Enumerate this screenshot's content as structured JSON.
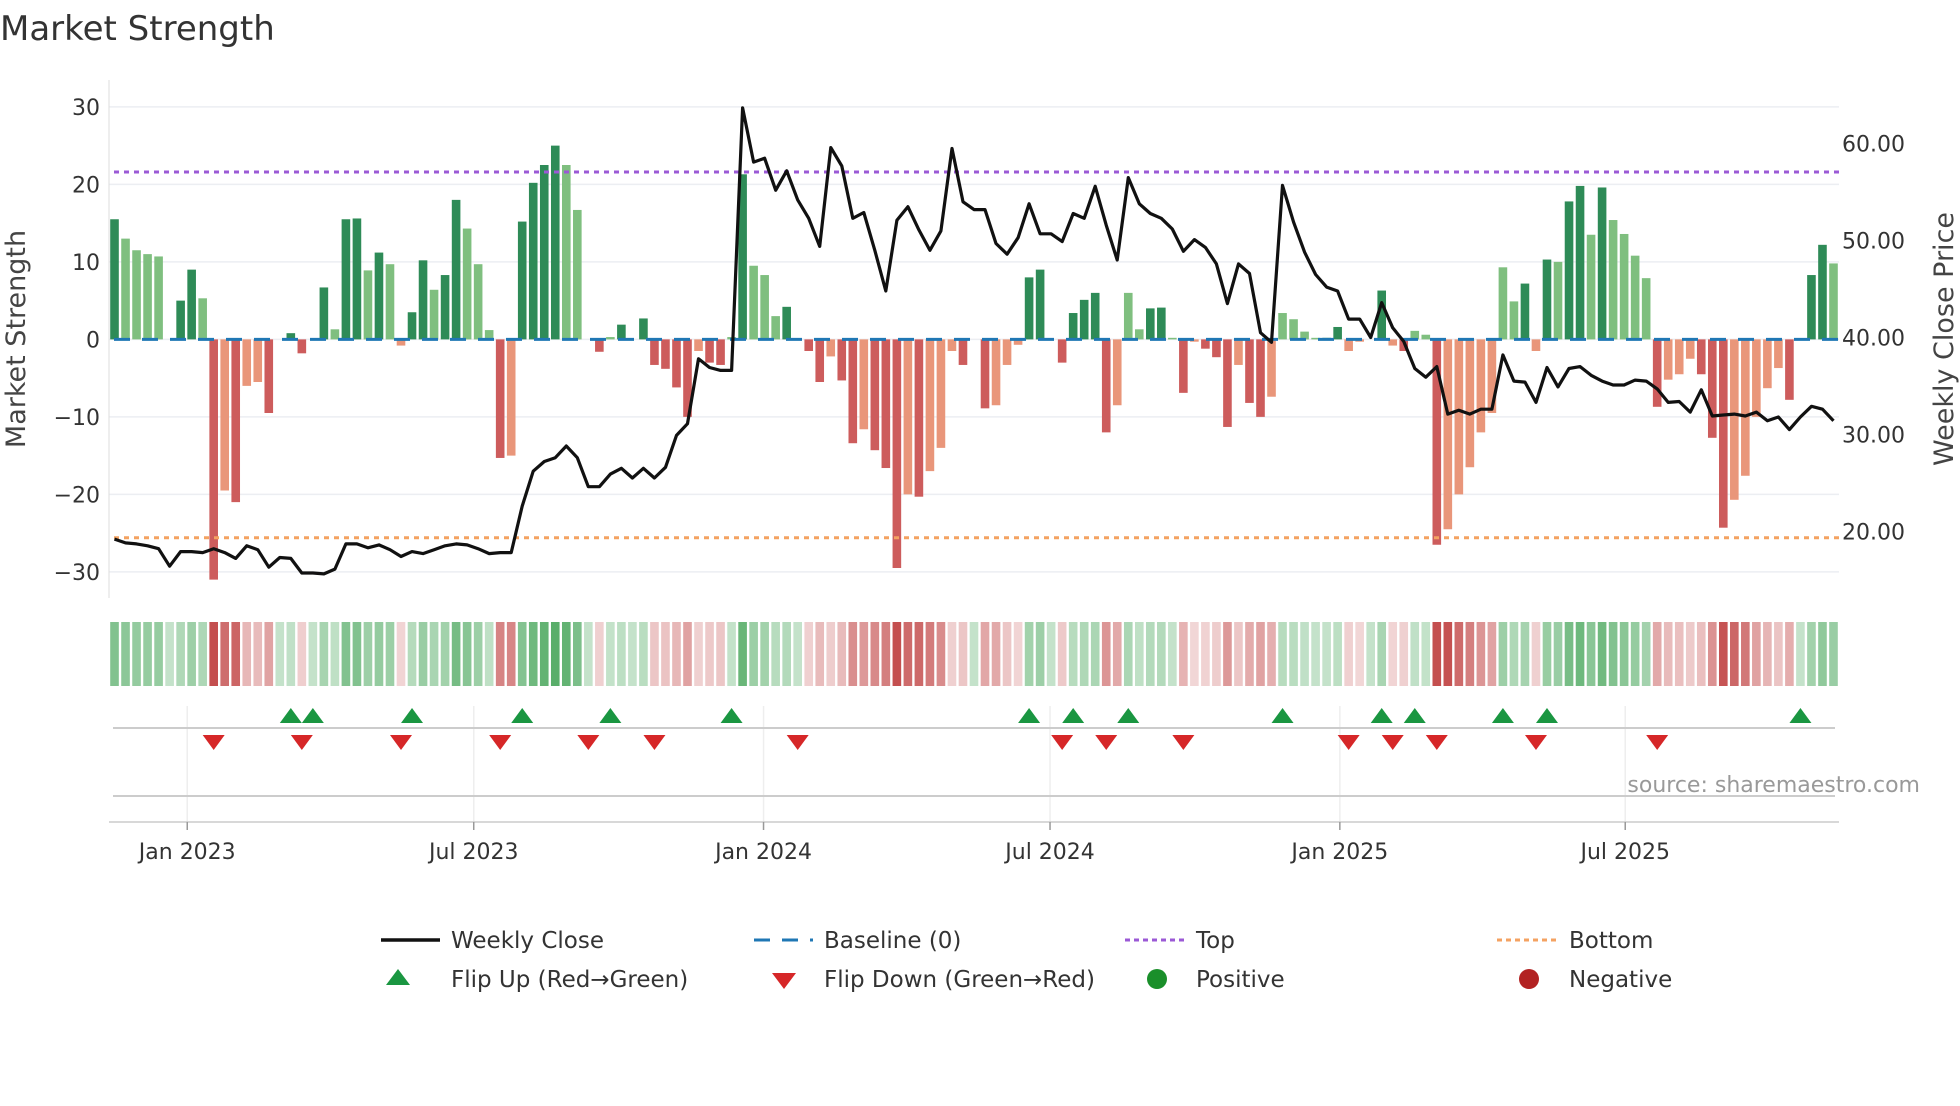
{
  "chart_data": {
    "type": "bar",
    "title": "Market Strength",
    "ylabel": "Market Strength",
    "y2label": "Weekly Close Price",
    "ylim": [
      -33,
      33
    ],
    "y2lim": [
      15.2,
      67.7
    ],
    "yticks": [
      "30",
      "20",
      "10",
      "0",
      "−10",
      "−20",
      "−30"
    ],
    "ytick_values": [
      30,
      20,
      10,
      0,
      -10,
      -20,
      -30
    ],
    "y2ticks": [
      "60.00",
      "50.00",
      "40.00",
      "30.00",
      "20.00"
    ],
    "y2tick_values": [
      60,
      50,
      40,
      30,
      20
    ],
    "x_unit": "week index (weekly, starting mid-Nov 2022)",
    "xticks": [
      {
        "label": "Jan 2023",
        "week": 6.6
      },
      {
        "label": "Jul 2023",
        "week": 32.6
      },
      {
        "label": "Jan 2024",
        "week": 58.9
      },
      {
        "label": "Jul 2024",
        "week": 84.9
      },
      {
        "label": "Jan 2025",
        "week": 111.2
      },
      {
        "label": "Jul 2025",
        "week": 137.1
      }
    ],
    "top_level": 21.6,
    "bottom_level": -25.6,
    "baseline": 0,
    "strength": [
      15.5,
      13,
      11.5,
      11,
      10.7,
      0,
      5,
      9,
      5.3,
      -31,
      -19.5,
      -21,
      -6,
      -5.5,
      -9.5,
      0,
      0.8,
      -1.8,
      0,
      6.7,
      1.3,
      15.5,
      15.6,
      8.9,
      11.2,
      9.7,
      -0.8,
      3.5,
      10.2,
      6.4,
      8.3,
      18,
      14.3,
      9.7,
      1.2,
      -15.3,
      -15,
      15.2,
      20.2,
      22.5,
      25,
      22.5,
      16.7,
      0,
      -1.6,
      0.3,
      1.9,
      0,
      2.7,
      -3.3,
      -3.8,
      -6.2,
      -10,
      -1.5,
      -3,
      -3.3,
      0.3,
      21.3,
      9.5,
      8.3,
      3,
      4.2,
      0,
      -1.5,
      -5.5,
      -2.2,
      -5.3,
      -13.4,
      -11.6,
      -14.3,
      -16.6,
      -29.5,
      -20,
      -20.3,
      -17,
      -14,
      -1.5,
      -3.3,
      0,
      -8.9,
      -8.5,
      -3.3,
      -0.7,
      8,
      9,
      0,
      -3,
      3.4,
      5.1,
      6,
      -12,
      -8.5,
      6,
      1.3,
      4,
      4.1,
      0.2,
      -6.9,
      -0.3,
      -1.2,
      -2.3,
      -11.3,
      -3.3,
      -8.2,
      -10,
      -7.4,
      3.4,
      2.6,
      1,
      0.2,
      0.2,
      1.6,
      -1.5,
      -0.3,
      0,
      6.3,
      -0.8,
      -1.5,
      1.1,
      0.6,
      -26.5,
      -24.5,
      -20,
      -16.5,
      -12,
      -9.5,
      9.3,
      4.9,
      7.2,
      -1.5,
      10.3,
      10,
      17.8,
      19.8,
      13.5,
      19.6,
      15.4,
      13.6,
      10.8,
      7.9,
      -8.7,
      -5.2,
      -4.5,
      -2.5,
      -4.5,
      -12.7,
      -24.3,
      -20.7,
      -17.6,
      -10,
      -6.3,
      -3.7,
      -7.8,
      0,
      8.3,
      12.2,
      9.8
    ],
    "weekly_close": [
      19.2,
      18.8,
      18.7,
      18.5,
      18.2,
      16.4,
      17.9,
      17.9,
      17.8,
      18.2,
      17.8,
      17.2,
      18.5,
      18.1,
      16.3,
      17.3,
      17.2,
      15.7,
      15.7,
      15.6,
      16.1,
      18.7,
      18.7,
      18.3,
      18.6,
      18.1,
      17.4,
      17.9,
      17.7,
      18.1,
      18.5,
      18.7,
      18.6,
      18.2,
      17.7,
      17.8,
      17.8,
      22.6,
      26.2,
      27.2,
      27.6,
      28.8,
      27.6,
      24.6,
      24.6,
      25.9,
      26.5,
      25.5,
      26.5,
      25.5,
      26.6,
      29.9,
      31.1,
      37.8,
      36.9,
      36.6,
      36.6,
      63.7,
      58.1,
      58.5,
      55.2,
      57.2,
      54.2,
      52.3,
      49.4,
      59.6,
      57.7,
      52.3,
      52.9,
      49.0,
      44.8,
      52.1,
      53.5,
      51.1,
      49.0,
      51.0,
      59.5,
      54.0,
      53.2,
      53.2,
      49.7,
      48.6,
      50.3,
      53.8,
      50.7,
      50.7,
      49.9,
      52.8,
      52.3,
      55.6,
      51.6,
      48.0,
      56.5,
      53.8,
      52.8,
      52.3,
      51.2,
      48.9,
      50.1,
      49.3,
      47.6,
      43.5,
      47.6,
      46.6,
      40.5,
      39.5,
      55.7,
      51.9,
      48.8,
      46.5,
      45.2,
      44.8,
      41.9,
      41.9,
      40.0,
      43.6,
      41.0,
      39.6,
      36.8,
      35.9,
      37.0,
      32.1,
      32.5,
      32.1,
      32.6,
      32.6,
      38.2,
      35.5,
      35.4,
      33.3,
      36.9,
      34.9,
      36.8,
      37.0,
      36.1,
      35.5,
      35.1,
      35.1,
      35.6,
      35.5,
      34.7,
      33.3,
      33.4,
      32.3,
      34.6,
      31.9,
      32.0,
      32.1,
      31.9,
      32.3,
      31.4,
      31.8,
      30.5,
      31.8,
      32.9,
      32.6,
      31.4
    ],
    "flip_up_weeks": [
      16,
      18,
      27,
      37,
      45,
      56,
      83,
      87,
      92,
      106,
      115,
      118,
      126,
      130,
      153
    ],
    "flip_down_weeks": [
      9,
      17,
      26,
      35,
      43,
      49,
      62,
      86,
      90,
      97,
      112,
      116,
      120,
      129,
      140
    ],
    "grid": true,
    "legend_position": "bottom",
    "legend": {
      "weekly_close": "Weekly Close",
      "baseline": "Baseline (0)",
      "top": "Top",
      "bottom": "Bottom",
      "flip_up": "Flip Up (Red→Green)",
      "flip_down": "Flip Down (Green→Red)",
      "positive": "Positive",
      "negative": "Negative"
    },
    "source": "source: sharemaestro.com",
    "colors": {
      "strong_pos": "#2e8b57",
      "weak_pos": "#7fbf7f",
      "strong_neg": "#cd5c5c",
      "weak_neg": "#e9967a",
      "line": "#111111",
      "baseline": "#1f77b4",
      "top": "#9b59d6",
      "bottom": "#f4a261",
      "flip_up": "#1a9641",
      "flip_down": "#d62728",
      "positive": "#1a8f2a",
      "negative": "#b22222"
    }
  }
}
